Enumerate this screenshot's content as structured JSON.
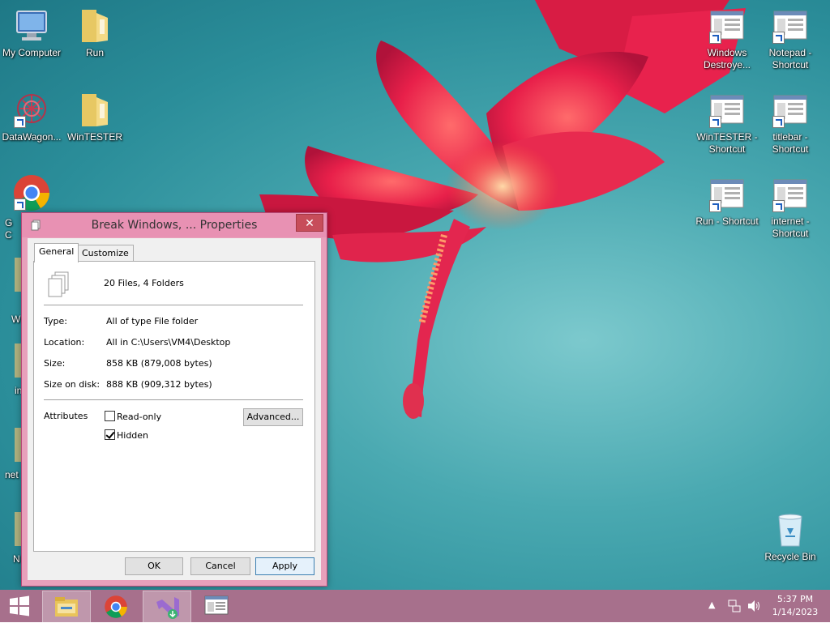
{
  "desktop": {
    "icons_left": [
      {
        "label": "My Computer",
        "icon": "computer-icon"
      },
      {
        "label": "Run",
        "icon": "folder-icon"
      },
      {
        "label": "DataWagon...",
        "icon": "datawagon-icon"
      },
      {
        "label": "WinTESTER",
        "icon": "folder-icon"
      },
      {
        "label": "G\nC",
        "icon": "chrome-icon"
      }
    ],
    "icons_right": [
      {
        "label": "Windows Destroye...",
        "icon": "window-shortcut-icon"
      },
      {
        "label": "Notepad - Shortcut",
        "icon": "window-shortcut-icon"
      },
      {
        "label": "WinTESTER - Shortcut",
        "icon": "window-shortcut-icon"
      },
      {
        "label": "titlebar - Shortcut",
        "icon": "window-shortcut-icon"
      },
      {
        "label": "Run - Shortcut",
        "icon": "window-shortcut-icon"
      },
      {
        "label": "internet - Shortcut",
        "icon": "window-shortcut-icon"
      }
    ],
    "recycle_bin": {
      "label": "Recycle Bin",
      "icon": "recycle-bin-icon"
    },
    "partial_labels": [
      "W",
      "in",
      "net",
      "N"
    ]
  },
  "dialog": {
    "title": "Break Windows, ... Properties",
    "close_glyph": "✕",
    "tabs": [
      {
        "label": "General"
      },
      {
        "label": "Customize"
      }
    ],
    "summary": "20 Files, 4 Folders",
    "fields": [
      {
        "label": "Type:",
        "value": "All of type File folder"
      },
      {
        "label": "Location:",
        "value": "All in C:\\Users\\VM4\\Desktop"
      },
      {
        "label": "Size:",
        "value": "858 KB (879,008 bytes)"
      },
      {
        "label": "Size on disk:",
        "value": "888 KB (909,312 bytes)"
      }
    ],
    "attributes_label": "Attributes",
    "readonly_label": "Read-only",
    "readonly_checked": false,
    "hidden_label": "Hidden",
    "hidden_checked": true,
    "advanced_label": "Advanced...",
    "ok_label": "OK",
    "cancel_label": "Cancel",
    "apply_label": "Apply"
  },
  "taskbar": {
    "items": [
      {
        "name": "start-button",
        "icon": "windows-logo-icon"
      },
      {
        "name": "file-explorer",
        "icon": "file-explorer-icon"
      },
      {
        "name": "chrome",
        "icon": "chrome-icon"
      },
      {
        "name": "visual-studio-installer",
        "icon": "visual-studio-icon"
      },
      {
        "name": "app-window",
        "icon": "window-icon"
      }
    ],
    "time": "5:37 PM",
    "date": "1/14/2023"
  },
  "colors": {
    "accent_pink": "#e891b3",
    "taskbar": "#a7708c",
    "close_button": "#c74d5a"
  }
}
